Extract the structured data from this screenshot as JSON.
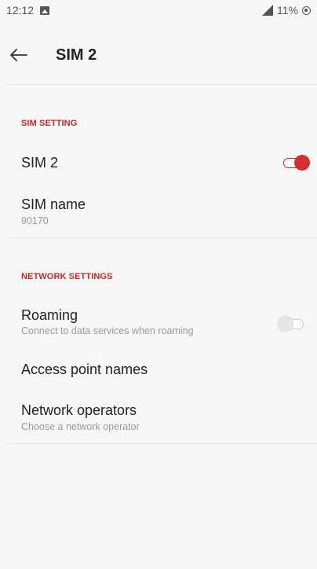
{
  "status_bar": {
    "time": "12:12",
    "battery": "11%"
  },
  "toolbar": {
    "title": "SIM 2"
  },
  "sections": {
    "sim_setting": "SIM SETTING",
    "network_settings": "NETWORK SETTINGS"
  },
  "items": {
    "sim2": {
      "title": "SIM 2",
      "enabled": true
    },
    "sim_name": {
      "title": "SIM name",
      "value": "90170"
    },
    "roaming": {
      "title": "Roaming",
      "summary": "Connect to data services when roaming",
      "enabled": false
    },
    "apn": {
      "title": "Access point names"
    },
    "operators": {
      "title": "Network operators",
      "summary": "Choose a network operator"
    }
  },
  "colors": {
    "accent": "#d32f2f",
    "section_header": "#c62828",
    "background": "#f7f7f7"
  }
}
